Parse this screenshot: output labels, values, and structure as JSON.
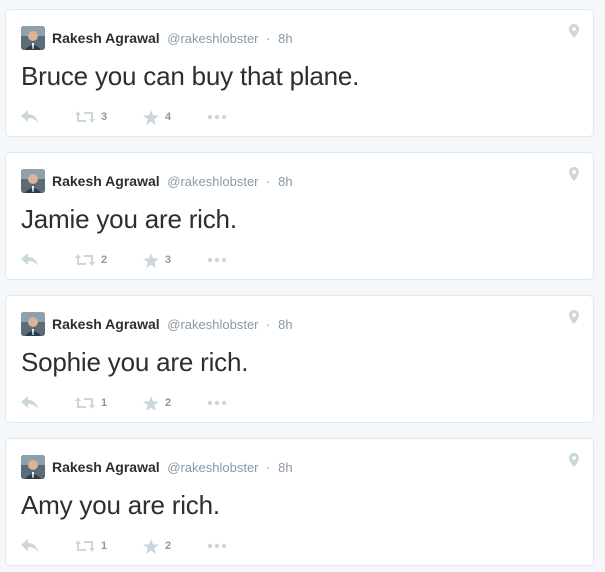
{
  "colors": {
    "background": "#f5f8fa",
    "card": "#ffffff",
    "border": "#e1e8ed",
    "name": "#292f33",
    "muted": "#8899a6",
    "icon": "#ccd6dd"
  },
  "icons": {
    "reply": "reply-icon",
    "retweet": "retweet-icon",
    "favorite": "star-icon",
    "more": "more-dots-icon",
    "geo": "location-pin-icon"
  },
  "tweets": [
    {
      "author_name": "Rakesh Agrawal",
      "handle": "@rakeshlobster",
      "separator": "·",
      "time": "8h",
      "text": "Bruce you can buy that plane.",
      "retweets": "3",
      "favorites": "4"
    },
    {
      "author_name": "Rakesh Agrawal",
      "handle": "@rakeshlobster",
      "separator": "·",
      "time": "8h",
      "text": "Jamie you are rich.",
      "retweets": "2",
      "favorites": "3"
    },
    {
      "author_name": "Rakesh Agrawal",
      "handle": "@rakeshlobster",
      "separator": "·",
      "time": "8h",
      "text": "Sophie you are rich.",
      "retweets": "1",
      "favorites": "2"
    },
    {
      "author_name": "Rakesh Agrawal",
      "handle": "@rakeshlobster",
      "separator": "·",
      "time": "8h",
      "text": "Amy you are rich.",
      "retweets": "1",
      "favorites": "2"
    }
  ]
}
